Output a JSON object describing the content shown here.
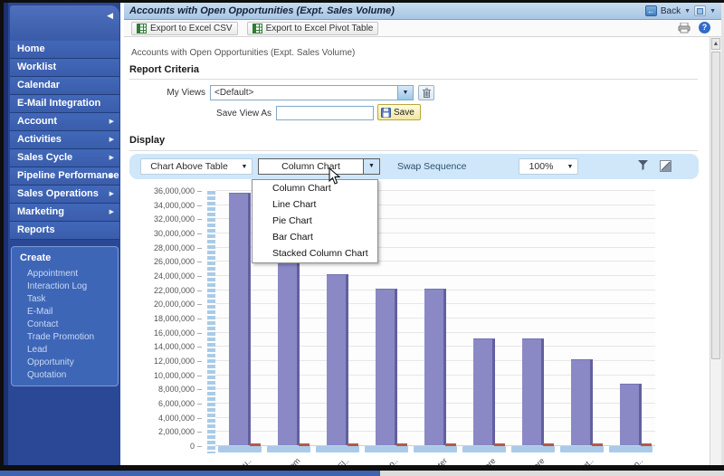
{
  "titlebar": {
    "title": "Accounts with Open Opportunities (Expt. Sales Volume)",
    "back_label": "Back"
  },
  "toolbar": {
    "export_csv_label": "Export to Excel CSV",
    "export_pivot_label": "Export to Excel Pivot Table",
    "help_glyph": "?"
  },
  "icons": {
    "back": "←",
    "collapse": "◀",
    "submenu": "▶",
    "dropdown": "▼",
    "scroll_up": "▲"
  },
  "sidebar": {
    "items": [
      {
        "label": "Home",
        "has_submenu": false
      },
      {
        "label": "Worklist",
        "has_submenu": false
      },
      {
        "label": "Calendar",
        "has_submenu": false
      },
      {
        "label": "E-Mail Integration",
        "has_submenu": false
      },
      {
        "label": "Account Management",
        "has_submenu": true
      },
      {
        "label": "Activities",
        "has_submenu": true
      },
      {
        "label": "Sales Cycle",
        "has_submenu": true
      },
      {
        "label": "Pipeline Performance",
        "has_submenu": true
      },
      {
        "label": "Sales Operations",
        "has_submenu": true
      },
      {
        "label": "Marketing",
        "has_submenu": true
      },
      {
        "label": "Reports",
        "has_submenu": false
      }
    ],
    "create": {
      "heading": "Create",
      "items": [
        "Appointment",
        "Interaction Log",
        "Task",
        "E-Mail",
        "Contact",
        "Trade Promotion",
        "Lead",
        "Opportunity",
        "Quotation"
      ]
    }
  },
  "report": {
    "subtitle": "Accounts with Open Opportunities (Expt. Sales Volume)",
    "criteria_heading": "Report Criteria",
    "my_views_label": "My Views",
    "my_views_value": "<Default>",
    "save_view_as_label": "Save View As",
    "save_view_as_value": "",
    "save_button_label": "Save",
    "display_heading": "Display"
  },
  "display_toolbar": {
    "layout_value": "Chart Above Table",
    "chart_type_value": "Column Chart",
    "swap_sequence_label": "Swap Sequence",
    "zoom_value": "100%"
  },
  "chart_type_menu": {
    "options": [
      "Column Chart",
      "Line Chart",
      "Pie Chart",
      "Bar Chart",
      "Stacked Column Chart"
    ]
  },
  "chart_data": {
    "type": "bar",
    "title": "Accounts with Open Opportunities (Expt. Sales Volume)",
    "categories": [
      "..mpu..",
      "..b Com",
      "..n El..",
      "..omp..",
      "..Center",
      "..Store",
      "..Store",
      "..n Int..",
      "..ohn.."
    ],
    "series": [
      {
        "name": "series-1-columns",
        "color": "#8a88c5",
        "values": [
          35500000,
          28000000,
          24000000,
          22000000,
          22000000,
          15000000,
          15000000,
          12000000,
          8500000
        ]
      },
      {
        "name": "series-2-base-markers",
        "color": "#b5584b",
        "values": [
          250000,
          250000,
          250000,
          250000,
          250000,
          250000,
          250000,
          250000,
          250000
        ]
      }
    ],
    "ylim": [
      0,
      36000000
    ],
    "ytick_step": 2000000,
    "xlabel": "",
    "ylabel": "",
    "grid": true,
    "legend": false,
    "note_second_column_partially_hidden_by_menu": true
  },
  "colors": {
    "sidebar_blue": "#2a4896",
    "toolbar_blue": "#cfe7f9",
    "axis_blue": "#a9cbe9",
    "bar_fill": "#8a88c5",
    "bar_edge": "#62609f",
    "marker_red": "#b5584b"
  }
}
